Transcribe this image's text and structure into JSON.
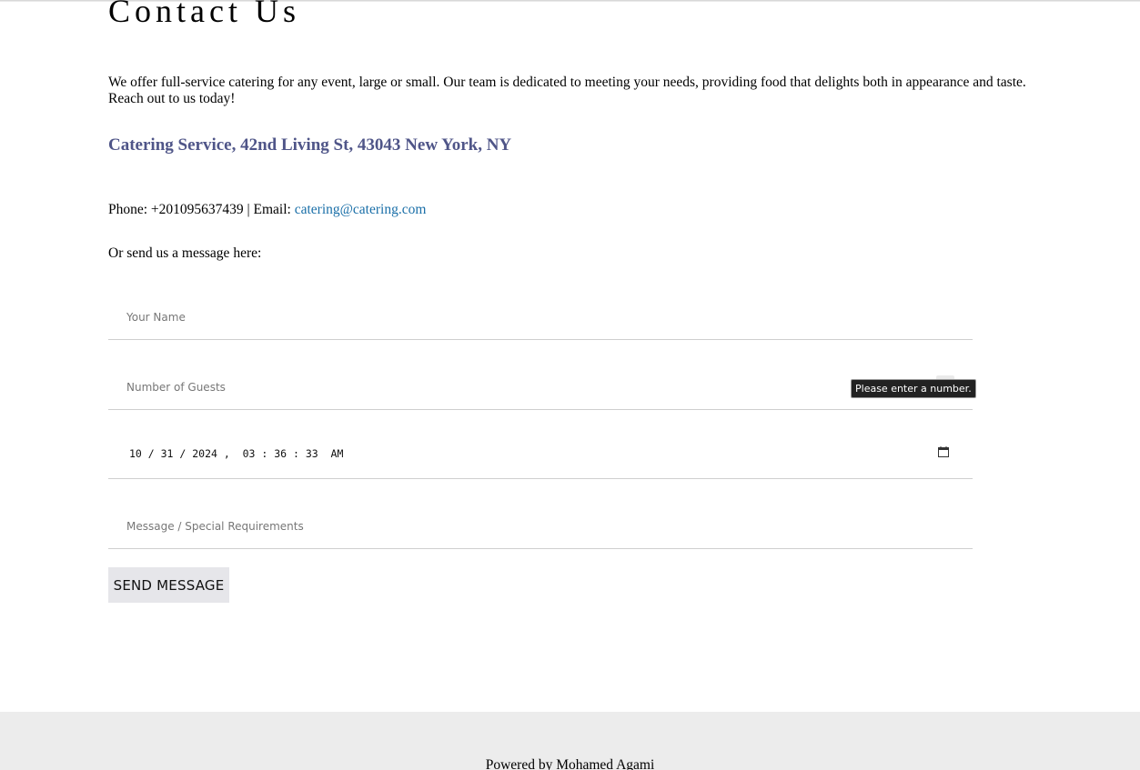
{
  "page": {
    "heading": "Contact Us",
    "intro": "We offer full-service catering for any event, large or small. Our team is dedicated to meeting your needs, providing food that delights both in appearance and taste. Reach out to us today!",
    "address": "Catering Service, 42nd Living St, 43043 New York, NY",
    "phone_prefix": "Phone: +201095637439 | Email: ",
    "email": "catering@catering.com",
    "message_prompt": "Or send us a message here:"
  },
  "form": {
    "name_placeholder": "Your Name",
    "guests_placeholder": "Number of Guests",
    "datetime_value": "10 / 31 / 2024 ,  03 : 36 : 33  AM",
    "message_placeholder": "Message / Special Requirements",
    "submit_label": "SEND MESSAGE",
    "validation_tooltip": "Please enter a number."
  },
  "footer": {
    "text": "Powered by Mohamed Agami"
  },
  "icons": {
    "date_picker": "calendar-icon"
  },
  "colors": {
    "address": "#4f5588",
    "email_link": "#1a6fa8",
    "button_bg": "#e6e6ea",
    "footer_bg": "#ececec"
  }
}
